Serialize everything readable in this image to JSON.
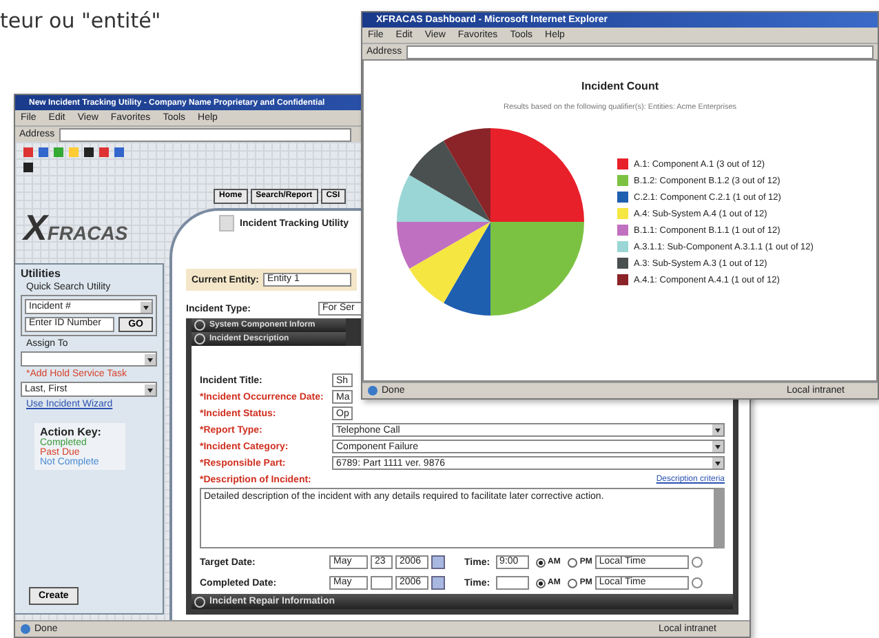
{
  "caption": "teur ou \"entité\"",
  "back_window": {
    "title": "New Incident Tracking Utility - Company Name Proprietary and Confidential",
    "menu": [
      "File",
      "Edit",
      "View",
      "Favorites",
      "Tools",
      "Help"
    ],
    "address_label": "Address",
    "logo": {
      "mark": "X",
      "word": "FRACAS"
    },
    "nav_buttons": [
      "Home",
      "Search/Report",
      "CSI"
    ],
    "page_title": "Incident Tracking Utility",
    "sidebar": {
      "heading": "Utilities",
      "quick_search_label": "Quick Search Utility",
      "search_select": "Incident #",
      "id_field": "Enter ID Number",
      "go_button": "GO",
      "assign_label": "Assign To",
      "task_link": "*Add Hold Service Task",
      "user_select": "Last, First",
      "wizard_link": "Use Incident Wizard",
      "action_key": {
        "title": "Action Key:",
        "items": [
          {
            "label": "Completed",
            "color": "#3a9a3a"
          },
          {
            "label": "Past Due",
            "color": "#d8402a"
          },
          {
            "label": "Not Complete",
            "color": "#4a8ad0"
          }
        ]
      },
      "create_button": "Create"
    },
    "current_entity_label": "Current Entity:",
    "current_entity": "Entity 1",
    "incident_type_label": "Incident Type:",
    "incident_type": "For Ser",
    "sections": [
      "System Component Inform",
      "Incident Description"
    ],
    "fields": [
      {
        "label": "Incident Title:",
        "required": false,
        "value": "Sh",
        "kind": "short"
      },
      {
        "label": "*Incident Occurrence Date:",
        "required": true,
        "value": "Ma",
        "kind": "short"
      },
      {
        "label": "*Incident Status:",
        "required": true,
        "value": "Op",
        "kind": "short"
      },
      {
        "label": "*Report Type:",
        "required": true,
        "value": "Telephone Call",
        "kind": "select"
      },
      {
        "label": "*Incident Category:",
        "required": true,
        "value": "Component Failure",
        "kind": "select"
      },
      {
        "label": "*Responsible Part:",
        "required": true,
        "value": "6789: Part 1111 ver. 9876",
        "kind": "select"
      }
    ],
    "description_label": "*Description of Incident:",
    "description_link": "Description criteria",
    "description": "Detailed description of the incident with any details required to facilitate later corrective action.",
    "date_rows": [
      {
        "label": "Target Date:",
        "month": "May",
        "day": "23",
        "year": "2006",
        "time_label": "Time:",
        "time": "9:00",
        "meridiem": [
          {
            "label": "AM",
            "selected": true
          },
          {
            "label": "PM",
            "selected": false
          }
        ],
        "zone": "Local Time"
      },
      {
        "label": "Completed Date:",
        "month": "May",
        "year": "2006",
        "time_label": "Time:",
        "meridiem": [
          {
            "label": "AM",
            "selected": true
          },
          {
            "label": "PM",
            "selected": false
          }
        ],
        "zone": "Local Time"
      }
    ],
    "repair_section": "Incident Repair Information",
    "status": "Done",
    "zone_status": "Local intranet"
  },
  "front_window": {
    "title": "XFRACAS Dashboard - Microsoft Internet Explorer",
    "menu": [
      "File",
      "Edit",
      "View",
      "Favorites",
      "Tools",
      "Help"
    ],
    "address_label": "Address",
    "subtitle": "Results based on the following qualifier(s): Entities: Acme Enterprises",
    "chart_data": {
      "type": "pie",
      "title": "Incident Count",
      "legend": "right",
      "categories": [
        "A.1: Component A.1 (3 out of 12)",
        "B.1.2: Component B.1.2 (3 out of 12)",
        "C.2.1: Component C.2.1 (1 out of 12)",
        "A.4: Sub-System A.4 (1 out of 12)",
        "B.1.1: Component B.1.1 (1 out of 12)",
        "A.3.1.1: Sub-Component A.3.1.1 (1 out of 12)",
        "A.3: Sub-System A.3 (1 out of 12)",
        "A.4.1: Component A.4.1 (1 out of 12)"
      ],
      "values": [
        3,
        3,
        1,
        1,
        1,
        1,
        1,
        1
      ],
      "colors": [
        "#e8202a",
        "#7cc242",
        "#1f5fb0",
        "#f5e642",
        "#c070c0",
        "#9ad6d6",
        "#4a5050",
        "#8a2428"
      ]
    },
    "status": "Done",
    "zone_status": "Local intranet"
  }
}
